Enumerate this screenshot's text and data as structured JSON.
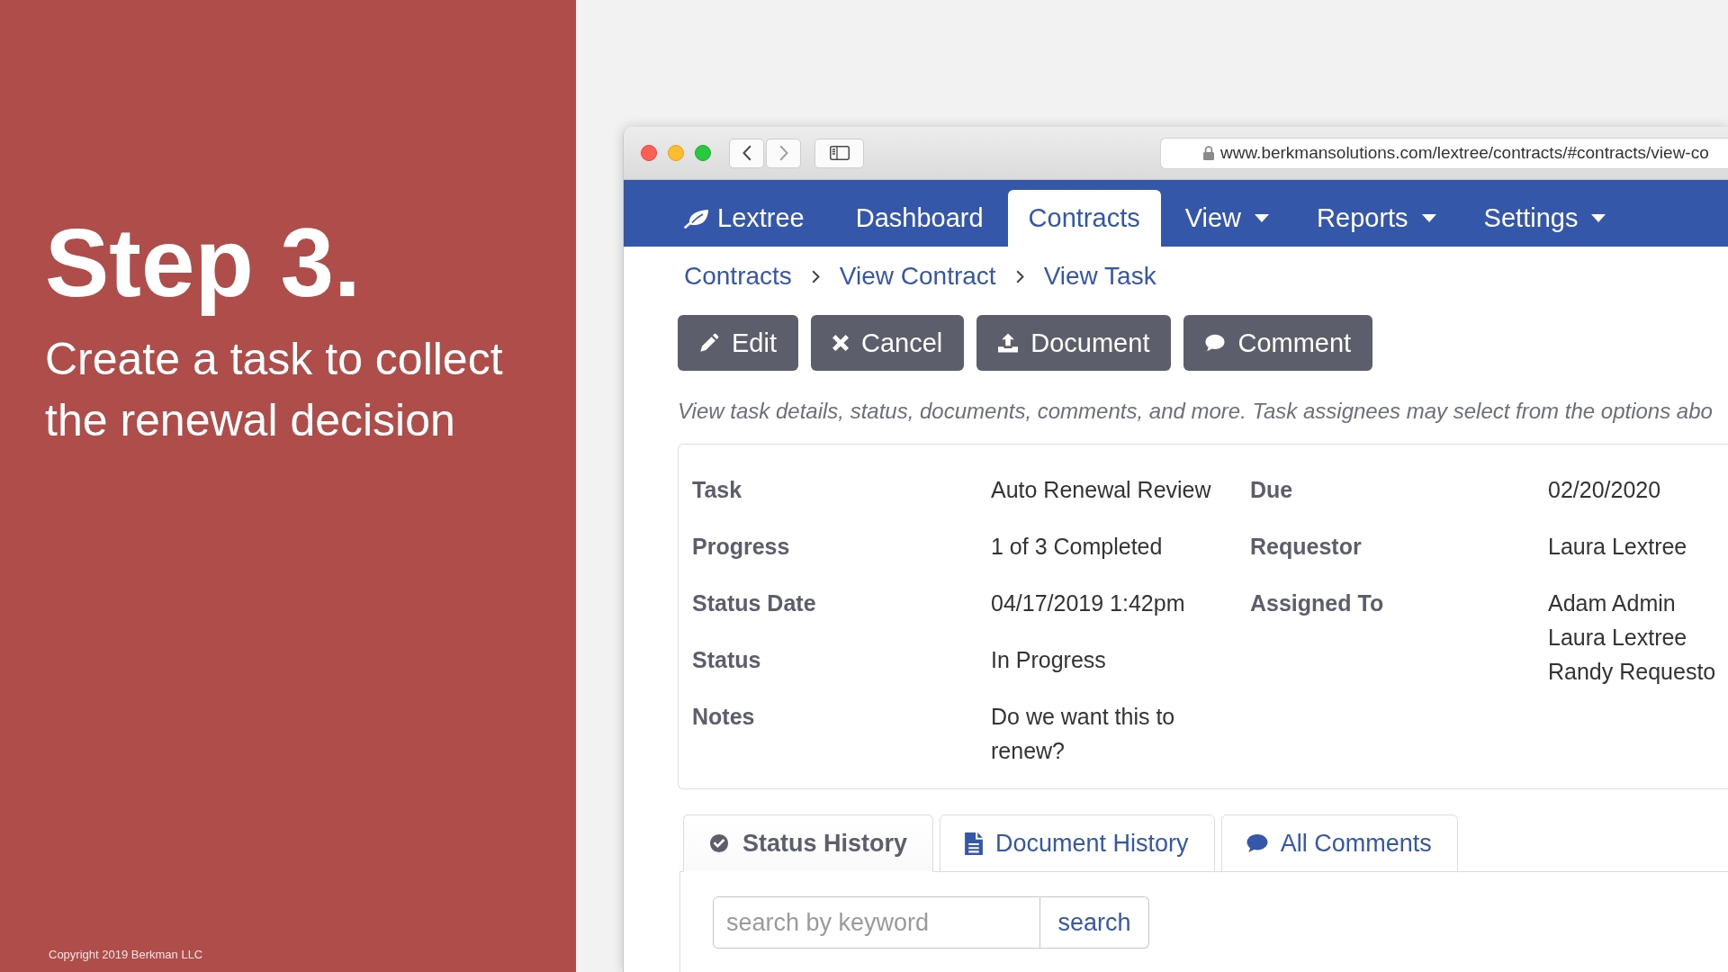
{
  "slide": {
    "heading": "Step 3.",
    "subheading": "Create a task to collect the renewal decision",
    "copyright": "Copyright 2019 Berkman LLC"
  },
  "browser": {
    "url": "www.berkmansolutions.com/lextree/contracts/#contracts/view-co"
  },
  "nav": [
    {
      "label": "Lextree",
      "kind": "brand",
      "selected": false
    },
    {
      "label": "Dashboard",
      "kind": "link",
      "selected": false
    },
    {
      "label": "Contracts",
      "kind": "link",
      "selected": true
    },
    {
      "label": "View",
      "kind": "dropdown",
      "selected": false
    },
    {
      "label": "Reports",
      "kind": "dropdown",
      "selected": false
    },
    {
      "label": "Settings",
      "kind": "dropdown",
      "selected": false
    }
  ],
  "breadcrumb": [
    "Contracts",
    "View Contract",
    "View Task"
  ],
  "actions": [
    "Edit",
    "Cancel",
    "Document",
    "Comment"
  ],
  "description": "View task details, status, documents, comments, and more. Task assignees may select from the options abo",
  "details": {
    "left": [
      {
        "label": "Task",
        "lines": [
          "Auto Renewal Review"
        ]
      },
      {
        "label": "Progress",
        "lines": [
          "1 of 3 Completed"
        ]
      },
      {
        "label": "Status Date",
        "lines": [
          "04/17/2019 1:42pm"
        ]
      },
      {
        "label": "Status",
        "lines": [
          "In Progress"
        ]
      },
      {
        "label": "Notes",
        "lines": [
          "Do we want this to renew?"
        ]
      }
    ],
    "right": [
      {
        "label": "Due",
        "lines": [
          "02/20/2020"
        ]
      },
      {
        "label": "Requestor",
        "lines": [
          "Laura Lextree"
        ]
      },
      {
        "label": "Assigned To",
        "lines": [
          "Adam Admin",
          "Laura Lextree",
          "Randy Requesto"
        ]
      }
    ]
  },
  "tabs": [
    {
      "label": "Status History",
      "selected": true
    },
    {
      "label": "Document History",
      "selected": false
    },
    {
      "label": "All Comments",
      "selected": false
    }
  ],
  "search": {
    "placeholder": "search by keyword",
    "button": "search"
  }
}
